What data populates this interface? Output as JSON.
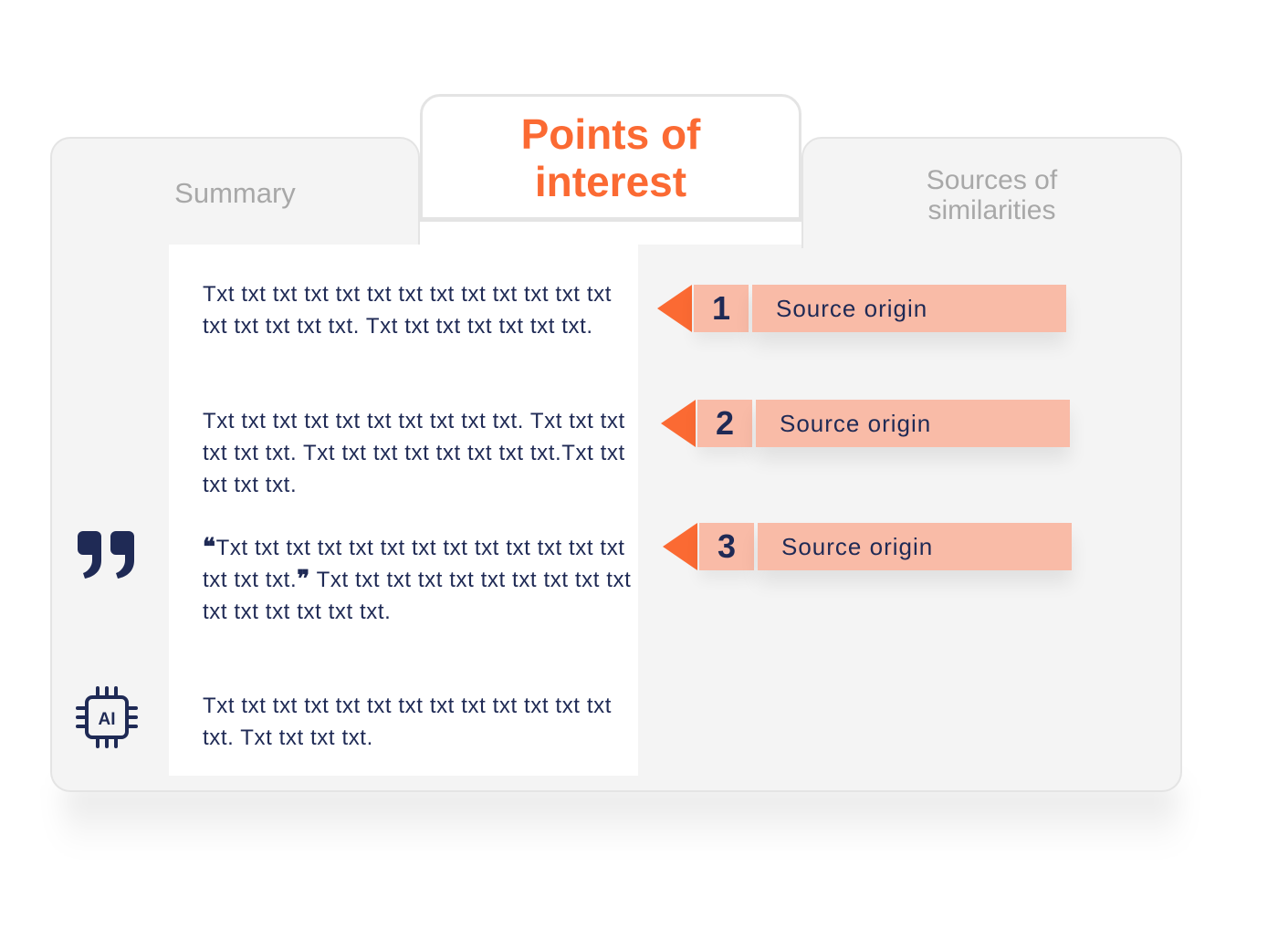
{
  "tabs": [
    {
      "label": "Summary",
      "active": false
    },
    {
      "label": "Points of interest",
      "active": true
    },
    {
      "label": "Sources of similarities",
      "active": false
    }
  ],
  "paragraphs": [
    "Txt txt txt txt txt txt txt txt txt txt txt txt txt txt txt txt txt txt. Txt txt txt txt txt txt txt.",
    "Txt txt txt txt txt txt txt txt txt txt. Txt txt txt txt txt txt. Txt txt txt txt txt txt txt txt.Txt txt txt txt txt.",
    {
      "quote_open": "❝",
      "quote": "Txt txt txt txt txt txt txt txt txt txt txt txt txt txt txt txt.",
      "quote_close": "❞",
      "rest": " Txt txt txt txt txt txt txt txt txt txt txt txt txt txt txt txt."
    },
    "Txt txt txt txt txt txt txt txt txt txt txt txt txt txt. Txt txt txt txt."
  ],
  "sources": [
    {
      "number": "1",
      "label": "Source origin"
    },
    {
      "number": "2",
      "label": "Source origin"
    },
    {
      "number": "3",
      "label": "Source origin"
    }
  ],
  "icons": {
    "quote_icon": "quote-icon",
    "ai_chip_icon": "ai-chip-icon",
    "ai_chip_text": "AI"
  },
  "colors": {
    "accent": "#fb6a33",
    "badge": "#f9bba7",
    "text": "#1f2a55",
    "panel": "#f4f4f4",
    "inactive_tab_text": "#a8a8a8"
  }
}
